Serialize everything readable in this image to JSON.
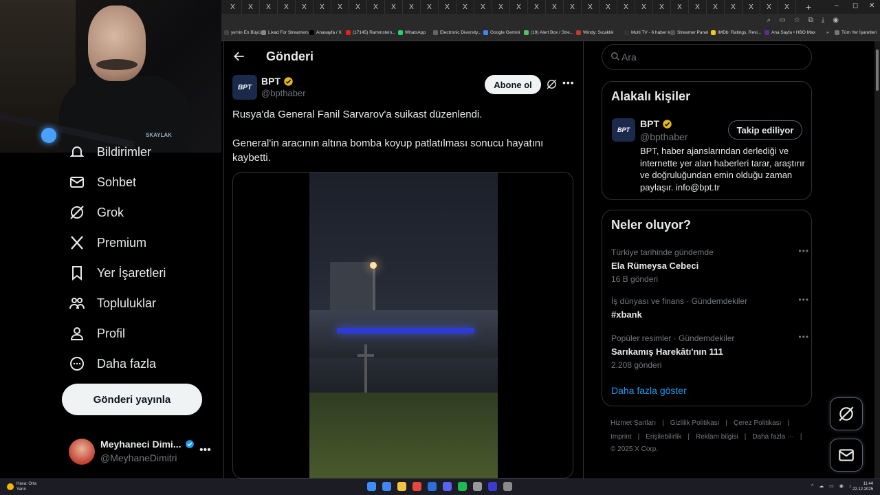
{
  "browser": {
    "tab_glyph": "X",
    "new_tab": "+",
    "window_controls": [
      "–",
      "◻",
      "✕"
    ],
    "bookmarks": [
      {
        "label": "ye'nin En Büyü...",
        "color": "#444"
      },
      {
        "label": "Lixad For Streamers",
        "color": "#888"
      },
      {
        "label": "Anasayfa / X",
        "color": "#000"
      },
      {
        "label": "(17145) Rammstein...",
        "color": "#e62117"
      },
      {
        "label": "WhatsApp",
        "color": "#25d366"
      },
      {
        "label": "Electronic Diversity...",
        "color": "#666"
      },
      {
        "label": "Google Gemini",
        "color": "#4285f4"
      },
      {
        "label": "(19) Alert Box / Stre...",
        "color": "#53c26b"
      },
      {
        "label": "Windy: Sıcaklık",
        "color": "#c0392b"
      },
      {
        "label": "Multi TV - 6 haber k...",
        "color": "#333"
      },
      {
        "label": "Streamer Panel",
        "color": "#555"
      },
      {
        "label": "IMDb: Ratings, Revi...",
        "color": "#f5c518"
      },
      {
        "label": "Ana Sayfa • HBO Max",
        "color": "#5c2d91"
      },
      {
        "label": "»",
        "color": "#2a2a2a"
      },
      {
        "label": "Tüm Yer İşaretleri",
        "color": "#777"
      }
    ]
  },
  "webcam": {
    "logo": "SKAYLAK"
  },
  "nav": {
    "items": [
      {
        "label": "Bildirimler",
        "icon": "bell-icon"
      },
      {
        "label": "Sohbet",
        "icon": "mail-icon"
      },
      {
        "label": "Grok",
        "icon": "grok-icon"
      },
      {
        "label": "Premium",
        "icon": "x-logo-icon"
      },
      {
        "label": "Yer İşaretleri",
        "icon": "bookmark-icon"
      },
      {
        "label": "Topluluklar",
        "icon": "communities-icon"
      },
      {
        "label": "Profil",
        "icon": "profile-icon"
      },
      {
        "label": "Daha fazla",
        "icon": "more-circle-icon"
      }
    ],
    "post_button": "Gönderi yayınla",
    "account": {
      "name": "Meyhaneci Dimi...",
      "handle": "@MeyhaneDimitri",
      "more": "•••"
    }
  },
  "main": {
    "header_title": "Gönderi",
    "tweet": {
      "avatar_text": "BPT",
      "name": "BPT",
      "handle": "@bpthaber",
      "subscribe": "Abone ol",
      "more": "•••",
      "text_1": "Rusya'da General Fanil Sarvarov'a suikast düzenlendi.",
      "text_2": "General'in aracının altına bomba koyup patlatılması sonucu hayatını kaybetti."
    }
  },
  "right": {
    "search_placeholder": "Ara",
    "related": {
      "title": "Alakalı kişiler",
      "avatar_text": "BPT",
      "name": "BPT",
      "handle": "@bpthaber",
      "follow": "Takip ediliyor",
      "bio": "BPT, haber ajanslarından derlediği ve internette yer alan haberleri tarar, araştırır ve doğruluğundan emin olduğu zaman paylaşır. info@bpt.tr"
    },
    "trends": {
      "title": "Neler oluyor?",
      "items": [
        {
          "context": "Türkiye tarihinde gündemde",
          "title": "Ela Rümeysa Cebeci",
          "count": "16 B gönderi"
        },
        {
          "context": "İş dünyası ve finans · Gündemdekiler",
          "title": "#xbank",
          "count": ""
        },
        {
          "context": "Popüler resimler · Gündemdekiler",
          "title": "Sarıkamış Harekâtı'nın 111",
          "count": "2.208 gönderi"
        }
      ],
      "show_more": "Daha fazla göster",
      "dots": "•••"
    },
    "footer": {
      "links_1": [
        "Hizmet Şartları",
        "Gizlilik Politikası",
        "Çerez Politikası"
      ],
      "links_2": [
        "Imprint",
        "Erişilebilirlik",
        "Reklam bilgisi",
        "Daha fazla ···"
      ],
      "sep": "|",
      "copyright": "© 2025 X Corp."
    }
  },
  "taskbar": {
    "weather_title": "Hava: Orta",
    "weather_sub": "Yarın",
    "tray": "^ ☁ ▭ ◉ ♪",
    "time": "11:44",
    "date": "22.12.2025",
    "apps": [
      "#3a8eff",
      "#4285f4",
      "#f4c542",
      "#e8483c",
      "#2a6fdb",
      "#5865f2",
      "#1db954",
      "#999",
      "#3b3bd1",
      "#8a8a8a"
    ]
  }
}
